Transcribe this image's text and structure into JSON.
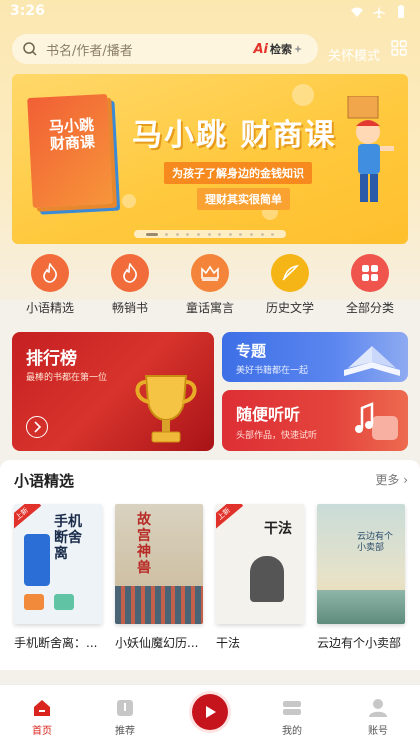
{
  "status_bar": {
    "time": "3:26"
  },
  "search": {
    "placeholder": "书名/作者/播者",
    "ai_label": "检索",
    "ai_mark": "Ai"
  },
  "header": {
    "care_mode": "关怀模式"
  },
  "banner": {
    "book_title": "马小跳 财商课",
    "title": "马小跳 财商课",
    "subtitle_1": "为孩子了解身边的金钱知识",
    "subtitle_2": "理财其实很简单",
    "slide_count": 12,
    "active_slide": 1
  },
  "categories": [
    {
      "label": "小语精选",
      "icon": "flame-icon",
      "color": "#f26b3a"
    },
    {
      "label": "畅销书",
      "icon": "flame-icon",
      "color": "#f26b3a"
    },
    {
      "label": "童话寓言",
      "icon": "crown-icon",
      "color": "#f3843a"
    },
    {
      "label": "历史文学",
      "icon": "quill-icon",
      "color": "#f5b517"
    },
    {
      "label": "全部分类",
      "icon": "grid-icon",
      "color": "#f0554d"
    }
  ],
  "cards": {
    "rank": {
      "title": "排行榜",
      "subtitle": "最棒的书都在第一位"
    },
    "topic": {
      "title": "专题",
      "subtitle": "美好书籍都在一起"
    },
    "listen": {
      "title": "随便听听",
      "subtitle": "头部作品，快速试听"
    }
  },
  "section": {
    "title": "小语精选",
    "more": "更多 ›",
    "books": [
      {
        "name": "手机断舍离：...",
        "cover_text": "手机断舍离",
        "tag": "上新"
      },
      {
        "name": "小妖仙魔幻历...",
        "cover_text": "故宫神兽",
        "tag": ""
      },
      {
        "name": "干法",
        "cover_text": "干法",
        "tag": "上新"
      },
      {
        "name": "云边有个小卖部",
        "cover_text": "云边有个小卖部",
        "tag": ""
      }
    ]
  },
  "bottom_nav": {
    "home": "首页",
    "recommend": "推荐",
    "mine": "我的",
    "account": "账号"
  },
  "colors": {
    "accent": "#d9251d",
    "rank_card": "#c51f22",
    "topic_card": "#3d6fe6"
  }
}
